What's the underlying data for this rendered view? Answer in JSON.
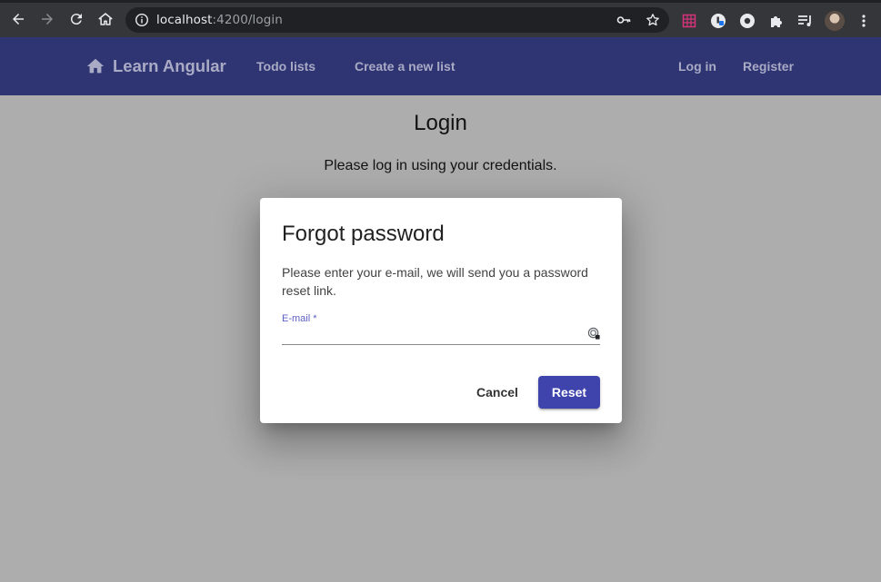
{
  "browser": {
    "url_host": "localhost",
    "url_path": ":4200/login",
    "nav_buttons": [
      "back-icon",
      "forward-icon",
      "reload-icon",
      "home-icon"
    ],
    "omnibox_icons": [
      "key-icon",
      "star-icon"
    ],
    "extension_icons": [
      "grid-extension-icon",
      "lock-extension-icon",
      "shield-extension-icon",
      "puzzle-icon",
      "media-queue-icon"
    ]
  },
  "toolbar": {
    "brand": "Learn Angular",
    "links": {
      "todo_lists": "Todo lists",
      "create_list": "Create a new list",
      "login": "Log in",
      "register": "Register"
    },
    "color": "#2f3473"
  },
  "page": {
    "title": "Login",
    "subtitle": "Please log in using your credentials."
  },
  "dialog": {
    "title": "Forgot password",
    "text": "Please enter your e-mail, we will send you a password reset link.",
    "email_label": "E-mail *",
    "email_value": "",
    "cancel_label": "Cancel",
    "reset_label": "Reset",
    "accent": "#3f44ad"
  }
}
